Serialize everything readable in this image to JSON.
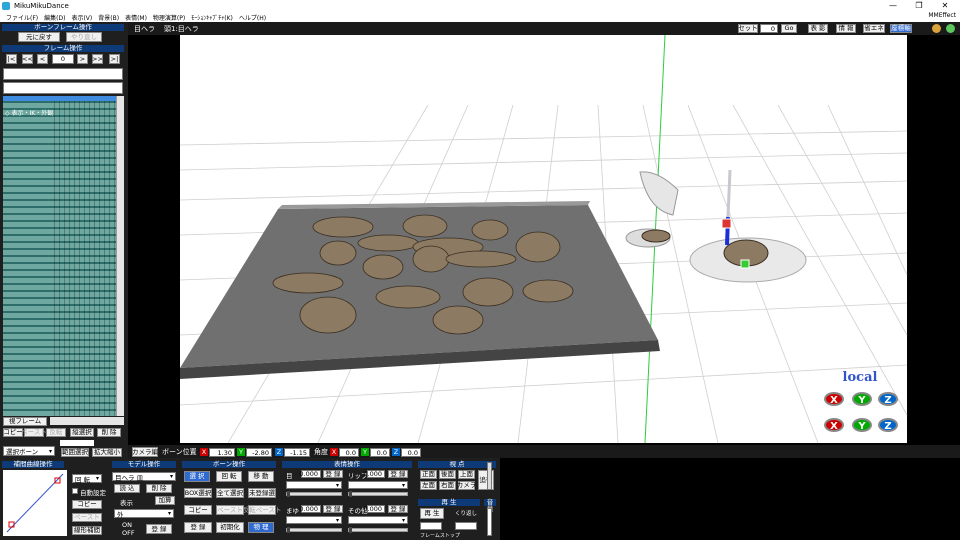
{
  "window": {
    "title": "MikuMikuDance",
    "controls": [
      "—",
      "❐",
      "✕"
    ]
  },
  "menu": [
    "ファイル(F)",
    "編集(D)",
    "表示(V)",
    "背景(B)",
    "表情(M)",
    "物理演算(P)",
    "ﾓｰｼｮﾝｷｬﾌﾟﾁｬ(K)",
    "ヘルプ(H)"
  ],
  "menu_right": "MMEffect",
  "left": {
    "bone_frame_header": "ボーンフレーム操作",
    "undo": "元に戻す",
    "redo": "やり直し",
    "frame_header": "フレーム操作",
    "frame_value": "0",
    "nav": [
      "|<",
      "<<",
      "<",
      ">",
      ">>",
      ">|"
    ],
    "tree": [
      "",
      ""
    ],
    "tree_items": [
      "◇ 表示・IK・外観"
    ],
    "view_frame": "視フレーム",
    "row1": [
      "コピー",
      "ペースト",
      "反転",
      "縦選択",
      "削 除"
    ],
    "sel_mode": "選択ボーン",
    "row2": [
      "範囲選択",
      "拡大縮小"
    ]
  },
  "viewport": {
    "model_label": "目ヘラ",
    "bone_label": "頭1:目ヘラ",
    "set_label": "セット",
    "set_value": "0",
    "go": "Go",
    "right_btns": [
      "表 影",
      "情 報",
      "省エネ",
      "座標軸"
    ],
    "local": "local",
    "axes": [
      "X",
      "Y",
      "Z",
      "X",
      "Y",
      "Z"
    ]
  },
  "status": {
    "camera": "カメラ編",
    "bone_pos": "ボーン位置",
    "x_val": "1.30",
    "y_val": "-2.80",
    "z_val": "-1.15",
    "angle": "角度",
    "ax": "0.0",
    "ay": "0.0",
    "az": "0.0"
  },
  "bottom": {
    "interp_header": "補間曲線操作",
    "rotate": "回 転",
    "auto": "自動設定",
    "copy": "コピー",
    "paste": "ペースト",
    "linear": "線形補間",
    "model_header": "モデル操作",
    "model_select": "目ヘラ 皿",
    "load": "読 込",
    "delete": "削 除",
    "display": "表示",
    "addition": "加算",
    "shadow": "外",
    "register": "登 録",
    "on": "ON",
    "off": "OFF",
    "bone_header": "ボーン操作",
    "bone_btns": [
      "選 択",
      "回 転",
      "移 動",
      "BOX選択",
      "全て選択",
      "未登録選",
      "コピー",
      "ペースト",
      "反転ペースト",
      "登 録",
      "初期化",
      "物 理"
    ],
    "morph_header": "表情操作",
    "eye": "目",
    "lip": "リップ",
    "brow": "まゆ",
    "other": "その他",
    "morph_val": "0.000",
    "morph_reg": "登 録",
    "view_header": "視 点",
    "view_btns": [
      "正面",
      "後面",
      "上面",
      "左面",
      "右面",
      "カメラ",
      "追従"
    ],
    "play_header": "再 生",
    "play": "再 生",
    "repeat": "くり返し",
    "frame_start": "フレームストップ",
    "vol": "音量"
  },
  "colors": {
    "accent": "#0e3a77",
    "x": "#cc0000",
    "y": "#00aa00",
    "z": "#0066cc"
  }
}
